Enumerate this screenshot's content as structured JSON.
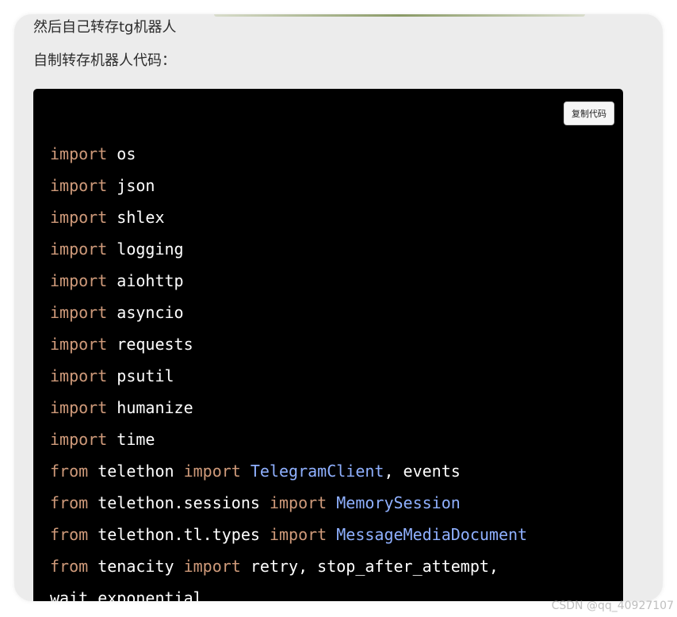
{
  "article": {
    "line1": "然后自己转存tg机器人",
    "line2": "自制转存机器人代码："
  },
  "code_block": {
    "copy_button_label": "复制代码",
    "language": "python",
    "colors": {
      "background": "#000000",
      "keyword": "#cf9a7a",
      "class_name": "#8fb0ff",
      "plain": "#ffffff"
    },
    "lines": [
      [
        {
          "t": "import",
          "k": "kw"
        },
        {
          "t": " os",
          "k": "plain"
        }
      ],
      [
        {
          "t": "import",
          "k": "kw"
        },
        {
          "t": " json",
          "k": "plain"
        }
      ],
      [
        {
          "t": "import",
          "k": "kw"
        },
        {
          "t": " shlex",
          "k": "plain"
        }
      ],
      [
        {
          "t": "import",
          "k": "kw"
        },
        {
          "t": " logging",
          "k": "plain"
        }
      ],
      [
        {
          "t": "import",
          "k": "kw"
        },
        {
          "t": " aiohttp",
          "k": "plain"
        }
      ],
      [
        {
          "t": "import",
          "k": "kw"
        },
        {
          "t": " asyncio",
          "k": "plain"
        }
      ],
      [
        {
          "t": "import",
          "k": "kw"
        },
        {
          "t": " requests",
          "k": "plain"
        }
      ],
      [
        {
          "t": "import",
          "k": "kw"
        },
        {
          "t": " psutil",
          "k": "plain"
        }
      ],
      [
        {
          "t": "import",
          "k": "kw"
        },
        {
          "t": " humanize",
          "k": "plain"
        }
      ],
      [
        {
          "t": "import",
          "k": "kw"
        },
        {
          "t": " time",
          "k": "plain"
        }
      ],
      [
        {
          "t": "from",
          "k": "kw"
        },
        {
          "t": " telethon ",
          "k": "plain"
        },
        {
          "t": "import",
          "k": "kw"
        },
        {
          "t": " ",
          "k": "plain"
        },
        {
          "t": "TelegramClient",
          "k": "cls"
        },
        {
          "t": ", events",
          "k": "plain"
        }
      ],
      [
        {
          "t": "from",
          "k": "kw"
        },
        {
          "t": " telethon.sessions ",
          "k": "plain"
        },
        {
          "t": "import",
          "k": "kw"
        },
        {
          "t": " ",
          "k": "plain"
        },
        {
          "t": "MemorySession",
          "k": "cls"
        }
      ],
      [
        {
          "t": "from",
          "k": "kw"
        },
        {
          "t": " telethon.tl.types ",
          "k": "plain"
        },
        {
          "t": "import",
          "k": "kw"
        },
        {
          "t": " ",
          "k": "plain"
        },
        {
          "t": "MessageMediaDocument",
          "k": "cls"
        }
      ],
      [
        {
          "t": "from",
          "k": "kw"
        },
        {
          "t": " tenacity ",
          "k": "plain"
        },
        {
          "t": "import",
          "k": "kw"
        },
        {
          "t": " retry, stop_after_attempt,",
          "k": "plain"
        }
      ],
      [
        {
          "t": "wait_exponential",
          "k": "plain"
        }
      ]
    ]
  },
  "watermark": "CSDN @qq_40927107"
}
